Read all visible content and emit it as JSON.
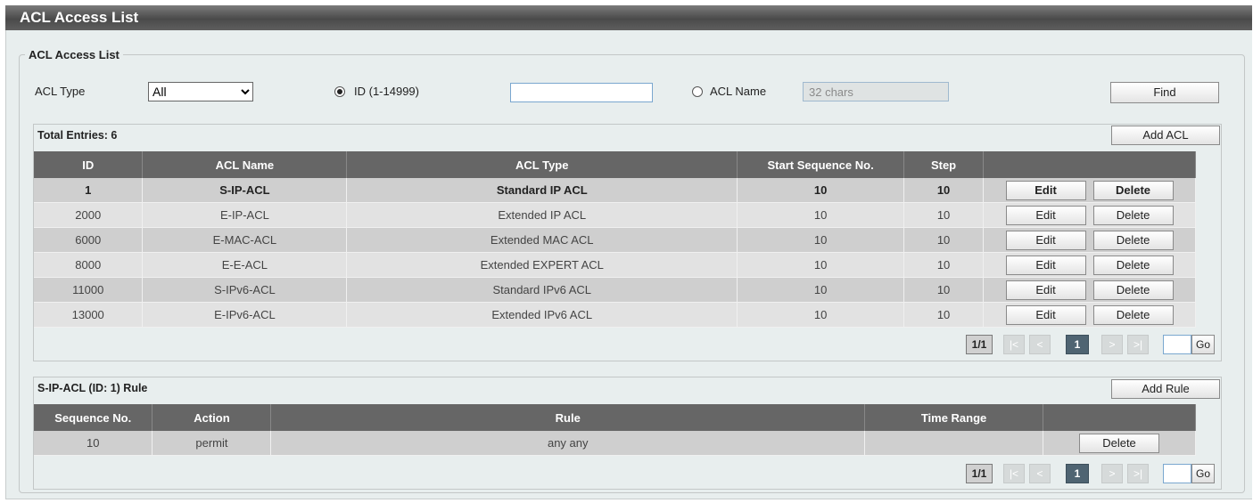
{
  "page": {
    "title": "ACL Access List"
  },
  "group": {
    "legend": "ACL Access List"
  },
  "filter": {
    "type_label": "ACL Type",
    "type_value": "All",
    "id_radio_label": "ID (1-14999)",
    "id_value": "",
    "name_radio_label": "ACL Name",
    "name_placeholder": "32 chars",
    "find_label": "Find"
  },
  "acl_table": {
    "total_label": "Total Entries: 6",
    "add_label": "Add ACL",
    "headers": [
      "ID",
      "ACL Name",
      "ACL Type",
      "Start Sequence No.",
      "Step",
      ""
    ],
    "rows": [
      {
        "id": "1",
        "name": "S-IP-ACL",
        "type": "Standard IP ACL",
        "start": "10",
        "step": "10"
      },
      {
        "id": "2000",
        "name": "E-IP-ACL",
        "type": "Extended IP ACL",
        "start": "10",
        "step": "10"
      },
      {
        "id": "6000",
        "name": "E-MAC-ACL",
        "type": "Extended MAC ACL",
        "start": "10",
        "step": "10"
      },
      {
        "id": "8000",
        "name": "E-E-ACL",
        "type": "Extended EXPERT ACL",
        "start": "10",
        "step": "10"
      },
      {
        "id": "11000",
        "name": "S-IPv6-ACL",
        "type": "Standard IPv6 ACL",
        "start": "10",
        "step": "10"
      },
      {
        "id": "13000",
        "name": "E-IPv6-ACL",
        "type": "Extended IPv6 ACL",
        "start": "10",
        "step": "10"
      }
    ],
    "edit_label": "Edit",
    "delete_label": "Delete"
  },
  "pager1": {
    "info": "1/1",
    "first": "|<",
    "prev": "<",
    "current": "1",
    "next": ">",
    "last": ">|",
    "go": "Go"
  },
  "rule_table": {
    "title": "S-IP-ACL (ID: 1) Rule",
    "add_label": "Add Rule",
    "headers": [
      "Sequence No.",
      "Action",
      "Rule",
      "Time Range",
      ""
    ],
    "rows": [
      {
        "seq": "10",
        "action": "permit",
        "rule": "any any",
        "time": ""
      }
    ],
    "delete_label": "Delete"
  },
  "pager2": {
    "info": "1/1",
    "first": "|<",
    "prev": "<",
    "current": "1",
    "next": ">",
    "last": ">|",
    "go": "Go"
  }
}
